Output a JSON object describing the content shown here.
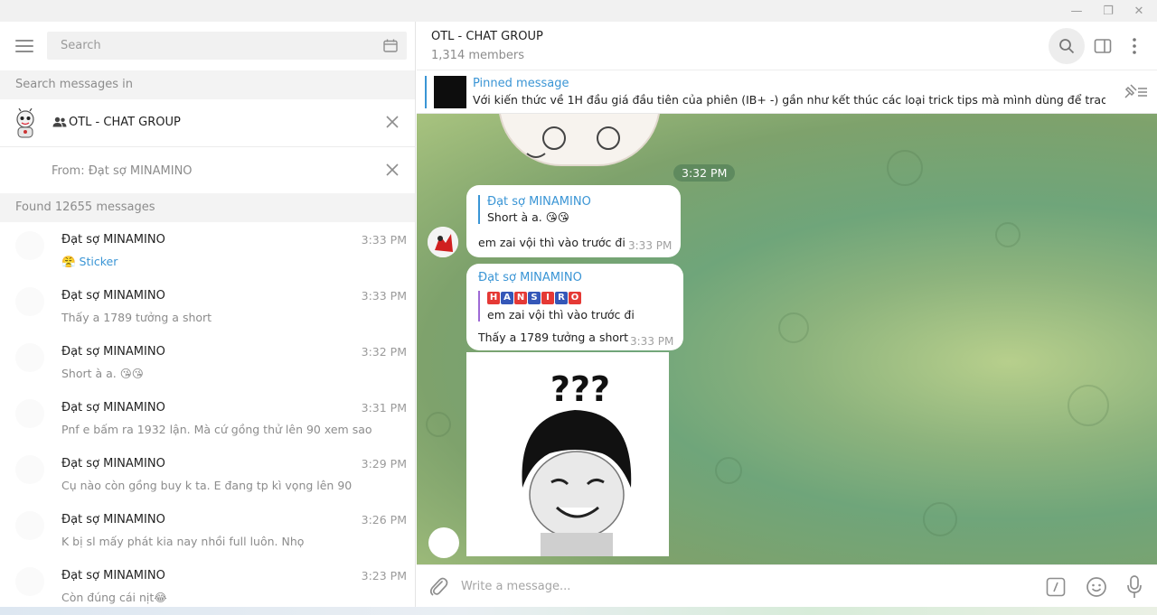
{
  "window": {
    "minimize_glyph": "—",
    "restore_glyph": "❐",
    "close_glyph": "✕"
  },
  "sidebar": {
    "search_placeholder": "Search",
    "search_in_label": "Search messages in",
    "chat_filter": "OTL - CHAT GROUP",
    "from_filter": "From: Đạt sợ MINAMINO",
    "found_label": "Found 12655 messages",
    "results": [
      {
        "name": "Đạt sợ MINAMINO",
        "time": "3:33 PM",
        "text": "😤 Sticker",
        "is_link": true
      },
      {
        "name": "Đạt sợ MINAMINO",
        "time": "3:33 PM",
        "text": "Thấy a 1789 tưởng a short",
        "is_link": false
      },
      {
        "name": "Đạt sợ MINAMINO",
        "time": "3:32 PM",
        "text": "Short à a. 😘😘",
        "is_link": false
      },
      {
        "name": "Đạt sợ MINAMINO",
        "time": "3:31 PM",
        "text": "Pnf e bấm ra 1932 lận. Mà cứ gồng thử lên 90 xem sao",
        "is_link": false
      },
      {
        "name": "Đạt sợ MINAMINO",
        "time": "3:29 PM",
        "text": "Cụ nào còn gồng buy k ta. E đang tp kì vọng lên 90",
        "is_link": false
      },
      {
        "name": "Đạt sợ MINAMINO",
        "time": "3:26 PM",
        "text": "K bị sl mấy phát kia nay nhồi full luôn. Nhọ",
        "is_link": false
      },
      {
        "name": "Đạt sợ MINAMINO",
        "time": "3:23 PM",
        "text": "Còn đúng cái nịt😂",
        "is_link": false
      }
    ]
  },
  "chat": {
    "title": "OTL - CHAT GROUP",
    "members": "1,314 members",
    "pinned_title": "Pinned message",
    "pinned_text": "Với kiến thức về 1H đầu giá đầu tiên của phiên (IB+ -) gần như kết thúc các loại trick tips mà mình dùng để trade. K...",
    "date_pill": "3:32 PM",
    "message1": {
      "reply_sender": "Đạt sợ MINAMINO",
      "reply_text": "Short à a. 😘😘",
      "text": "em zai vội thì vào trước đi",
      "time": "3:33 PM"
    },
    "message2": {
      "sender": "Đạt sợ MINAMINO",
      "reply_name": "HANSIRO",
      "reply_text": "em zai vội thì vào trước đi",
      "text": "Thấy a 1789 tưởng a short",
      "time": "3:33 PM"
    },
    "sticker_caption": "???",
    "composer_placeholder": "Write a message..."
  },
  "colors": {
    "accent": "#3a95d5",
    "reply_purple": "#9e6ad5",
    "hansiro_red": "#e53935",
    "hansiro_blue": "#3557b8"
  },
  "icons": [
    "menu-icon",
    "calendar-icon",
    "group-icon",
    "close-icon",
    "search-icon",
    "side-panel-icon",
    "more-icon",
    "unpin-icon",
    "attach-icon",
    "bot-command-icon",
    "emoji-icon",
    "microphone-icon"
  ]
}
